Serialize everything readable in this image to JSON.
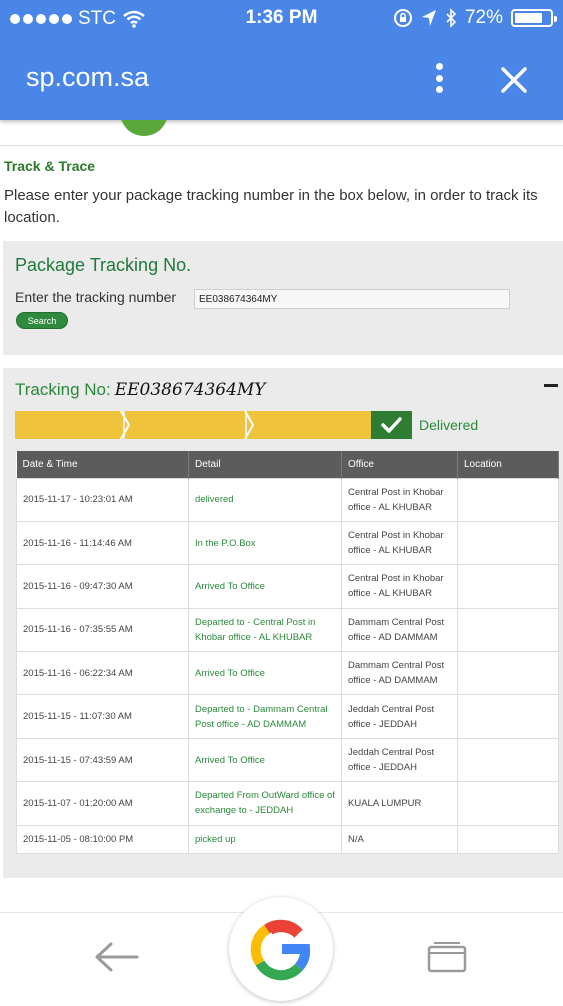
{
  "status_bar": {
    "carrier": "STC",
    "time": "1:36 PM",
    "battery": "72%",
    "signal_icon": "signal-dots-icon",
    "wifi_icon": "wifi-icon",
    "orientation_lock_icon": "orientation-lock-icon",
    "location_icon": "location-arrow-icon",
    "bluetooth_icon": "bluetooth-icon",
    "battery_level": 0.72
  },
  "browser": {
    "url": "sp.com.sa",
    "menu_icon": "more-vert-icon",
    "close_icon": "close-icon"
  },
  "page": {
    "section_title": "Track & Trace",
    "instructions": "Please enter your package tracking number in the box below, in order to track its location.",
    "form": {
      "title": "Package Tracking No.",
      "label": "Enter the tracking number",
      "value": "EE038674364MY",
      "search_label": "Search"
    },
    "result": {
      "label": "Tracking No:",
      "number": "EE038674364MY",
      "status": "Delivered",
      "collapse_icon": "minus-icon",
      "check_icon": "check-icon",
      "progress_steps_complete": 4,
      "columns": [
        "Date & Time",
        "Detail",
        "Office",
        "Location"
      ],
      "rows": [
        {
          "date": "2015-11-17 - 10:23:01 AM",
          "detail": "delivered",
          "office": "Central Post in Khobar office - AL KHUBAR",
          "location": ""
        },
        {
          "date": "2015-11-16 - 11:14:46 AM",
          "detail": "In the P.O.Box",
          "office": "Central Post in Khobar office - AL KHUBAR",
          "location": ""
        },
        {
          "date": "2015-11-16 - 09:47:30 AM",
          "detail": "Arrived To Office",
          "office": "Central Post in Khobar office - AL KHUBAR",
          "location": ""
        },
        {
          "date": "2015-11-16 - 07:35:55 AM",
          "detail": "Departed to - Central Post in Khobar office - AL KHUBAR",
          "office": "Dammam Central Post office - AD DAMMAM",
          "location": ""
        },
        {
          "date": "2015-11-16 - 06:22:34 AM",
          "detail": "Arrived To Office",
          "office": "Dammam Central Post office - AD DAMMAM",
          "location": ""
        },
        {
          "date": "2015-11-15 - 11:07:30 AM",
          "detail": "Departed to - Dammam Central Post office - AD DAMMAM",
          "office": "Jeddah Central Post office - JEDDAH",
          "location": ""
        },
        {
          "date": "2015-11-15 - 07:43:59 AM",
          "detail": "Arrived To Office",
          "office": "Jeddah Central Post office - JEDDAH",
          "location": ""
        },
        {
          "date": "2015-11-07 - 01:20:00 AM",
          "detail": "Departed From OutWard office of exchange to - JEDDAH",
          "office": "KUALA LUMPUR",
          "location": ""
        },
        {
          "date": "2015-11-05 - 08:10:00 PM",
          "detail": "picked up",
          "office": "N/A",
          "location": ""
        }
      ]
    }
  },
  "bottom_nav": {
    "back_icon": "back-arrow-icon",
    "google_icon": "google-g-icon",
    "tabs_icon": "tabs-icon"
  },
  "colors": {
    "browser_blue": "#4a86e8",
    "brand_green": "#2a8a3a",
    "progress_yellow": "#f0c33c",
    "delivered_green": "#2e7d32",
    "table_header": "#5c5c5c"
  }
}
